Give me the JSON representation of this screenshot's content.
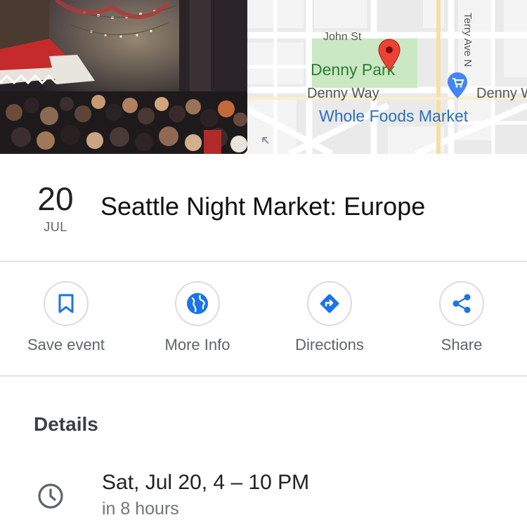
{
  "map": {
    "labels": {
      "john_st": "John St",
      "denny_park": "Denny Park",
      "denny_way": "Denny Way",
      "whole_foods": "Whole Foods Market",
      "terry_ave": "Terry Ave N",
      "denny_w": "Denny W"
    }
  },
  "event": {
    "day": "20",
    "month": "JUL",
    "title": "Seattle Night Market: Europe"
  },
  "actions": [
    {
      "label": "Save event",
      "icon": "bookmark-icon"
    },
    {
      "label": "More Info",
      "icon": "globe-icon"
    },
    {
      "label": "Directions",
      "icon": "directions-icon"
    },
    {
      "label": "Share",
      "icon": "share-icon"
    }
  ],
  "details": {
    "heading": "Details",
    "time": "Sat, Jul 20, 4 – 10 PM",
    "relative": "in 8 hours"
  },
  "colors": {
    "accent": "#1a73e8",
    "pin": "#ea4335",
    "park": "#c8e6c9",
    "park_text": "#2e7d32"
  }
}
